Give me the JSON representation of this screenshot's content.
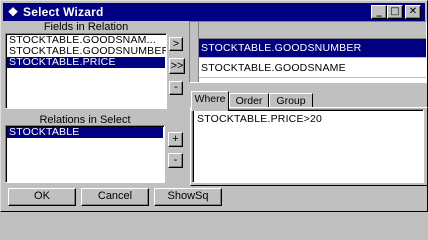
{
  "window": {
    "title": "Select Wizard",
    "controls": {
      "minimize": "_",
      "maximize": "□",
      "close": "✕"
    }
  },
  "fields_group": {
    "label": "Fields in Relation",
    "items": [
      "STOCKTABLE.GOODSNAM...",
      "STOCKTABLE.GOODSNUMBER",
      "STOCKTABLE.PRICE"
    ],
    "selected_index": 2
  },
  "move_buttons": {
    "add": ">",
    "add_all": ">>",
    "remove": "-"
  },
  "selected_grid": {
    "rows": [
      "STOCKTABLE.GOODSNUMBER",
      "STOCKTABLE.GOODSNAME"
    ],
    "selected_index": 0
  },
  "relations_group": {
    "label": "Relations in Select",
    "items": [
      "STOCKTABLE"
    ],
    "selected_index": 0
  },
  "relation_buttons": {
    "add": "+",
    "remove": "-"
  },
  "tabs": [
    "Where",
    "Order by",
    "Group by"
  ],
  "active_tab": 0,
  "where_clause": "STOCKTABLE.PRICE>20",
  "footer": {
    "ok": "OK",
    "cancel": "Cancel",
    "show_sql": "ShowSq"
  },
  "colors": {
    "title_bar": "#000080",
    "selection": "#000080",
    "face": "#c0c0c0"
  }
}
